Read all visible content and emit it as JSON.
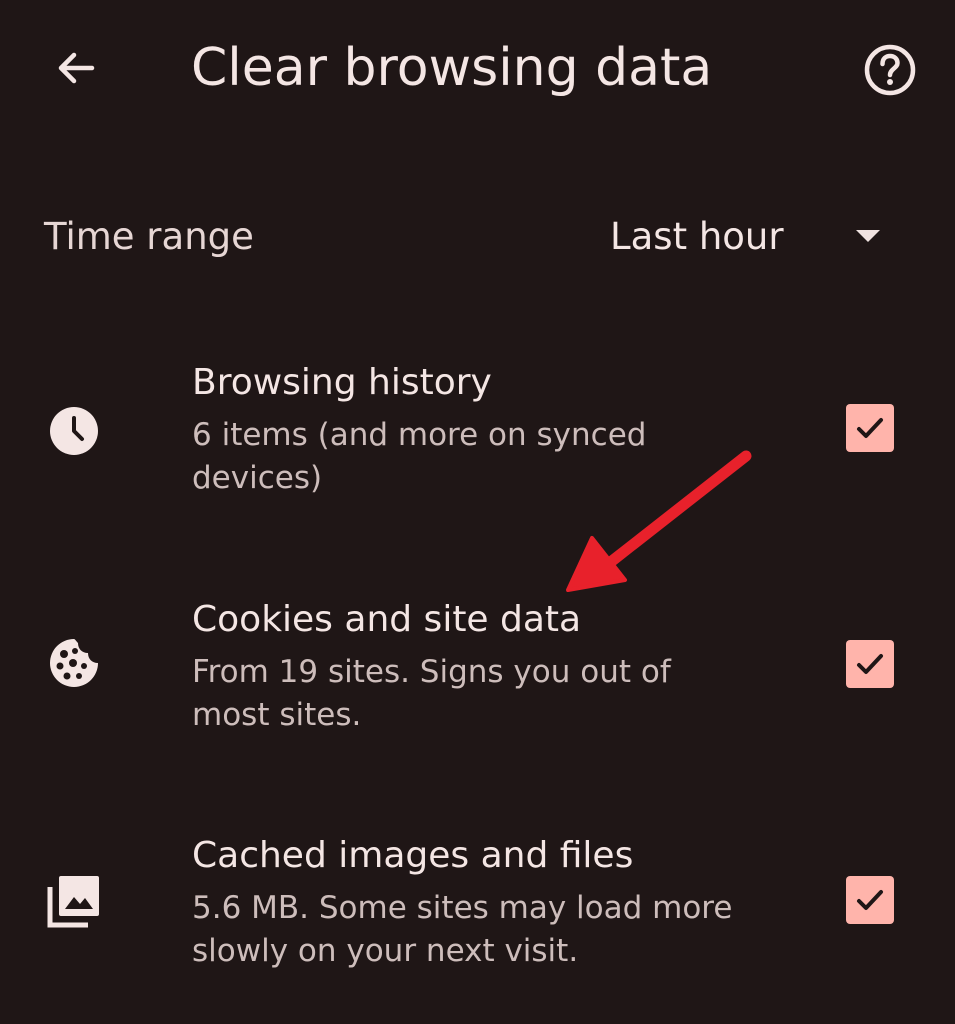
{
  "header": {
    "title": "Clear browsing data",
    "back_icon": "arrow-back-icon",
    "help_icon": "help-icon"
  },
  "time_range": {
    "label": "Time range",
    "selected": "Last hour"
  },
  "items": [
    {
      "icon": "clock-icon",
      "title": "Browsing history",
      "subtitle": "6 items (and more on synced devices)",
      "checked": true
    },
    {
      "icon": "cookie-icon",
      "title": "Cookies and site data",
      "subtitle": "From 19 sites. Signs you out of most sites.",
      "checked": true
    },
    {
      "icon": "image-stack-icon",
      "title": "Cached images and files",
      "subtitle": "5.6 MB. Some sites may load more slowly on your next visit.",
      "checked": true
    }
  ],
  "colors": {
    "background": "#1f1616",
    "checkbox": "#ffb4ab",
    "annotation_arrow": "#e8212b"
  }
}
